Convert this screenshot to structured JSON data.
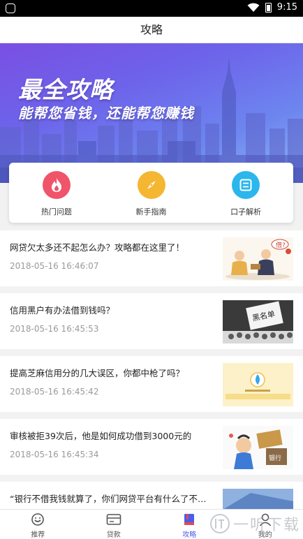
{
  "status_bar": {
    "time": "9:15"
  },
  "header": {
    "title": "攻略"
  },
  "banner": {
    "title": "最全攻略",
    "subtitle": "能帮您省钱，还能帮您赚钱"
  },
  "quick_links": [
    {
      "label": "热门问题",
      "icon": "flame-icon",
      "color": "#f0546a"
    },
    {
      "label": "新手指南",
      "icon": "compass-icon",
      "color": "#f5b631"
    },
    {
      "label": "口子解析",
      "icon": "document-icon",
      "color": "#2bb6ec"
    }
  ],
  "articles": [
    {
      "title": "网贷欠太多还不起怎么办？攻略都在这里了！",
      "date": "2018-05-16 16:46:07"
    },
    {
      "title": "信用黑户有办法借到钱吗？",
      "date": "2018-05-16 16:45:53"
    },
    {
      "title": "提高芝麻信用分的几大误区，你都中枪了吗？",
      "date": "2018-05-16 16:45:42"
    },
    {
      "title": "审核被拒39次后，他是如何成功借到3000元的",
      "date": "2018-05-16 16:45:34"
    },
    {
      "title": "“银行不借我钱就算了，你们网贷平台有什么了不起…",
      "date": ""
    }
  ],
  "thumbnail_text": {
    "blacklist": "黑名单",
    "borrow": "借?",
    "bank": "银行"
  },
  "tabs": [
    {
      "label": "推荐",
      "active": false
    },
    {
      "label": "贷款",
      "active": false
    },
    {
      "label": "攻略",
      "active": true
    },
    {
      "label": "我的",
      "active": false
    }
  ],
  "watermark": {
    "text": "一听下载"
  },
  "colors": {
    "accent": "#4a5ee8",
    "banner_start": "#7a4fe3",
    "banner_end": "#8eb4f2"
  }
}
